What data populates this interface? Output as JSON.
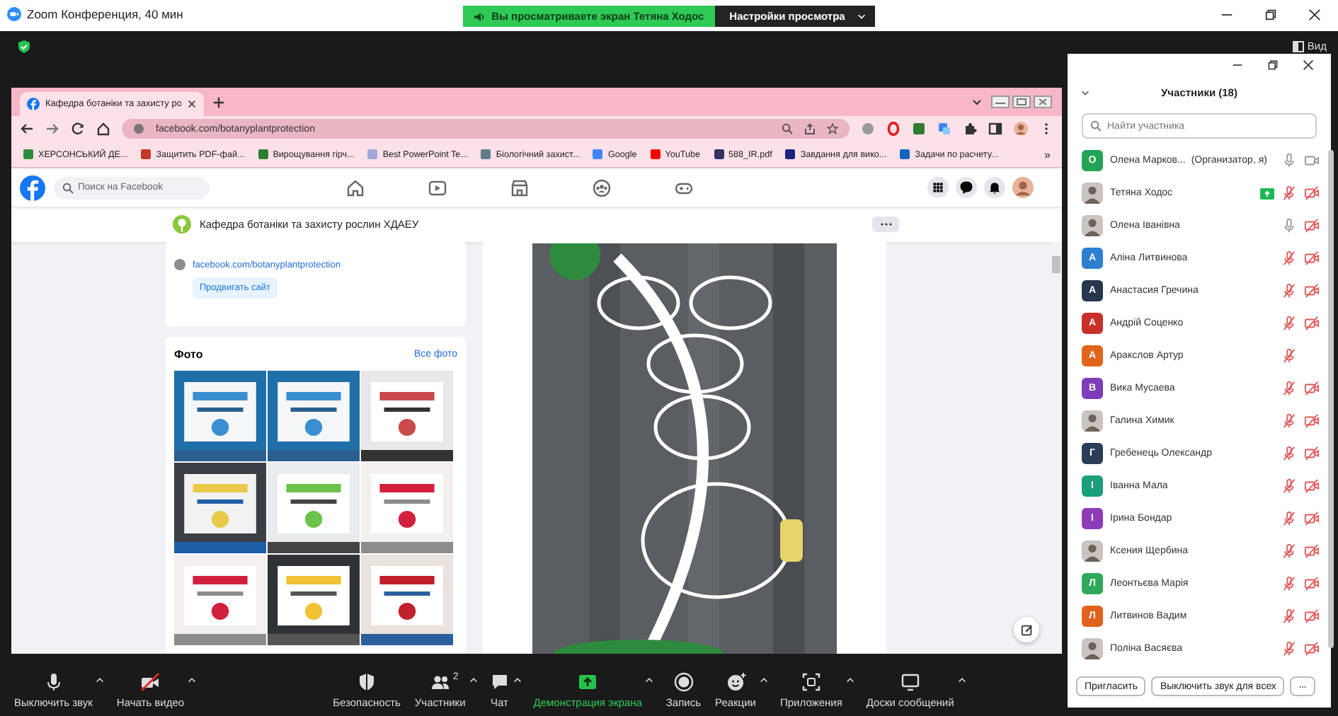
{
  "title_bar": {
    "title": "Zoom Конференция, 40 мин",
    "banner": "Вы просматриваете экран Тетяна Ходос",
    "view_options": "Настройки просмотра"
  },
  "view_button": "Вид",
  "browser": {
    "tab": "Кафедра ботаніки та захисту ро",
    "url": "facebook.com/botanyplantprotection",
    "bookmarks": [
      "ХЕРСОНСЬКИЙ ДЕ...",
      "Защитить PDF-фай...",
      "Вирощування гірч...",
      "Best PowerPoint Te...",
      "Біологічний захист...",
      "Google",
      "YouTube",
      "588_IR.pdf",
      "Завдання для вико...",
      "Задачи по расчету..."
    ],
    "more_bookmarks": "»"
  },
  "facebook": {
    "search_placeholder": "Поиск на Facebook",
    "page_title": "Кафедра ботаніки та захисту рослин ХДАЕУ",
    "website_link": "facebook.com/botanyplantprotection",
    "promote_button": "Продвигать сайт",
    "photos_title": "Фото",
    "all_photos": "Все фото"
  },
  "participants": {
    "title": "Участники (18)",
    "search_placeholder": "Найти участника",
    "list": [
      {
        "name": "Олена Марков...",
        "role": "(Организатор, я)",
        "avatar": {
          "kind": "letter",
          "letter": "О",
          "color": "#23a455"
        },
        "sharing": false,
        "muted": false,
        "video_shown": true,
        "video_on": true
      },
      {
        "name": "Тетяна Ходос",
        "sharing": true,
        "muted": true,
        "video_shown": true,
        "video_on": false
      },
      {
        "name": "Олена Іванівна",
        "sharing": false,
        "muted": false,
        "video_shown": true,
        "video_on": false
      },
      {
        "name": "Аліна Литвинова",
        "avatar": {
          "kind": "letter",
          "letter": "А",
          "color": "#2e7fd0"
        },
        "sharing": false,
        "muted": true,
        "video_shown": true,
        "video_on": false
      },
      {
        "name": "Анастасия Гречина",
        "avatar": {
          "kind": "letter",
          "letter": "А",
          "color": "#27374f"
        },
        "sharing": false,
        "muted": true,
        "video_shown": true,
        "video_on": false
      },
      {
        "name": "Андрій Соценко",
        "avatar": {
          "kind": "letter",
          "letter": "А",
          "color": "#c9302c"
        },
        "sharing": false,
        "muted": true,
        "video_shown": true,
        "video_on": false
      },
      {
        "name": "Аракслов Артур",
        "avatar": {
          "kind": "letter",
          "letter": "А",
          "color": "#e0651c"
        },
        "sharing": false,
        "muted": true,
        "video_shown": false
      },
      {
        "name": "Вика Мусаева",
        "avatar": {
          "kind": "letter",
          "letter": "В",
          "color": "#7d3cb8"
        },
        "sharing": false,
        "muted": true,
        "video_shown": true,
        "video_on": false
      },
      {
        "name": "Галина Химик",
        "sharing": false,
        "muted": true,
        "video_shown": true,
        "video_on": false
      },
      {
        "name": "Гребенець Олександр",
        "avatar": {
          "kind": "letter",
          "letter": "Г",
          "color": "#2b3d57"
        },
        "sharing": false,
        "muted": true,
        "video_shown": true,
        "video_on": false
      },
      {
        "name": "Іванна Мала",
        "avatar": {
          "kind": "letter",
          "letter": "І",
          "color": "#1a9f7a"
        },
        "sharing": false,
        "muted": true,
        "video_shown": true,
        "video_on": false
      },
      {
        "name": "Ірина Бондар",
        "avatar": {
          "kind": "letter",
          "letter": "І",
          "color": "#8e3bb8"
        },
        "sharing": false,
        "muted": true,
        "video_shown": true,
        "video_on": false
      },
      {
        "name": "Ксения Щербина",
        "sharing": false,
        "muted": true,
        "video_shown": true,
        "video_on": false
      },
      {
        "name": "Леонтьєва Марія",
        "avatar": {
          "kind": "letter",
          "letter": "Л",
          "color": "#2ea85a"
        },
        "sharing": false,
        "muted": true,
        "video_shown": true,
        "video_on": false
      },
      {
        "name": "Литвинов Вадим",
        "avatar": {
          "kind": "letter",
          "letter": "Л",
          "color": "#e0621c"
        },
        "sharing": false,
        "muted": true,
        "video_shown": true,
        "video_on": false
      },
      {
        "name": "Поліна Васяєва",
        "sharing": false,
        "muted": true,
        "video_shown": true,
        "video_on": false
      }
    ],
    "invite": "Пригласить",
    "mute_all": "Выключить звук для всех"
  },
  "toolbar": [
    {
      "label": "Выключить звук",
      "caret": true,
      "highlighted": false
    },
    {
      "label": "Начать видео",
      "caret": true,
      "highlighted": false
    },
    {
      "label": "Безопасность",
      "caret": false,
      "highlighted": false
    },
    {
      "label": "Участники",
      "badge": "2",
      "caret": true,
      "highlighted": false
    },
    {
      "label": "Чат",
      "caret": true,
      "highlighted": false
    },
    {
      "label": "Демонстрация экрана",
      "caret": true,
      "highlighted": true
    },
    {
      "label": "Запись",
      "caret": false,
      "highlighted": false
    },
    {
      "label": "Реакции",
      "caret": true,
      "highlighted": false
    },
    {
      "label": "Приложения",
      "caret": true,
      "highlighted": false
    },
    {
      "label": "Доски сообщений",
      "caret": true,
      "highlighted": false
    }
  ]
}
